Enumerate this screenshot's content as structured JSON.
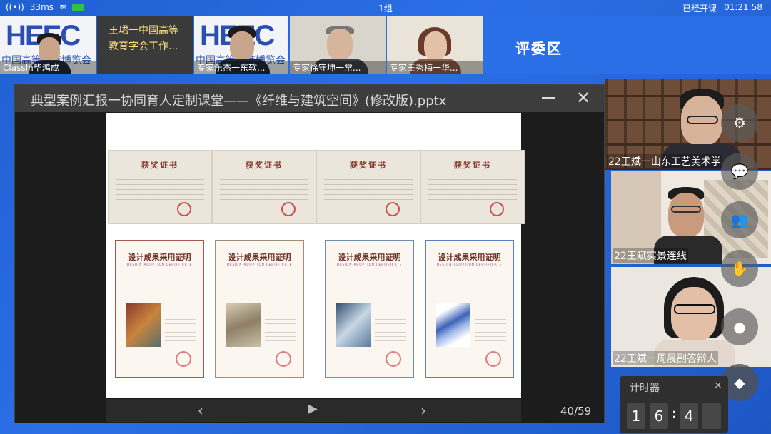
{
  "status": {
    "signal_ms": "33ms",
    "group": "1组",
    "class_state": "已经开课",
    "clock": "01:21:58"
  },
  "top_strip": [
    {
      "label": "ClassIn毕鸿成"
    },
    {
      "label": "王珺一中国高等教育学会工作..."
    },
    {
      "label": "专家乐杰一东软..."
    },
    {
      "label": "专家徐守坤一常..."
    },
    {
      "label": "专家王秀梅一华..."
    }
  ],
  "expo_logo": {
    "text": "HEEC",
    "sub": "中国高等教育博览会"
  },
  "judge_area": "评委区",
  "document": {
    "title": "典型案例汇报一协同育人定制课堂——《纤维与建筑空间》(修改版).pptx",
    "page": "40/59",
    "certs": [
      "获奖证书",
      "获奖证书",
      "获奖证书",
      "获奖证书"
    ],
    "proofs": [
      {
        "title": "设计成果采用证明",
        "en": "DESIGN ADOPTION CERTIFICATE",
        "color": "#a25a48"
      },
      {
        "title": "设计成果采用证明",
        "en": "DESIGN ADOPTION CERTIFICATE",
        "color": "#9f8f76"
      },
      {
        "title": "设计成果采用证明",
        "en": "DESIGN ADOPTION CERTIFICATE",
        "color": "#6f8fae"
      },
      {
        "title": "设计成果采用证明",
        "en": "DESIGN ADOPTION CERTIFICATE",
        "color": "#5d7fc4"
      }
    ]
  },
  "right_videos": [
    {
      "label": "22王斌一山东工艺美术学"
    },
    {
      "label": "22王斌实景连线"
    },
    {
      "label": "22王斌一周晨副答辩人"
    }
  ],
  "tools": [
    "gear-icon",
    "chat-icon",
    "people-icon",
    "hand-icon",
    "record-icon",
    "eraser-icon"
  ],
  "timer": {
    "label": "计时器",
    "digits": [
      "1",
      "6",
      "4",
      ""
    ],
    "close": "×"
  },
  "colors": {
    "accent": "#2b6fe6",
    "window": "#1c1c1c"
  }
}
